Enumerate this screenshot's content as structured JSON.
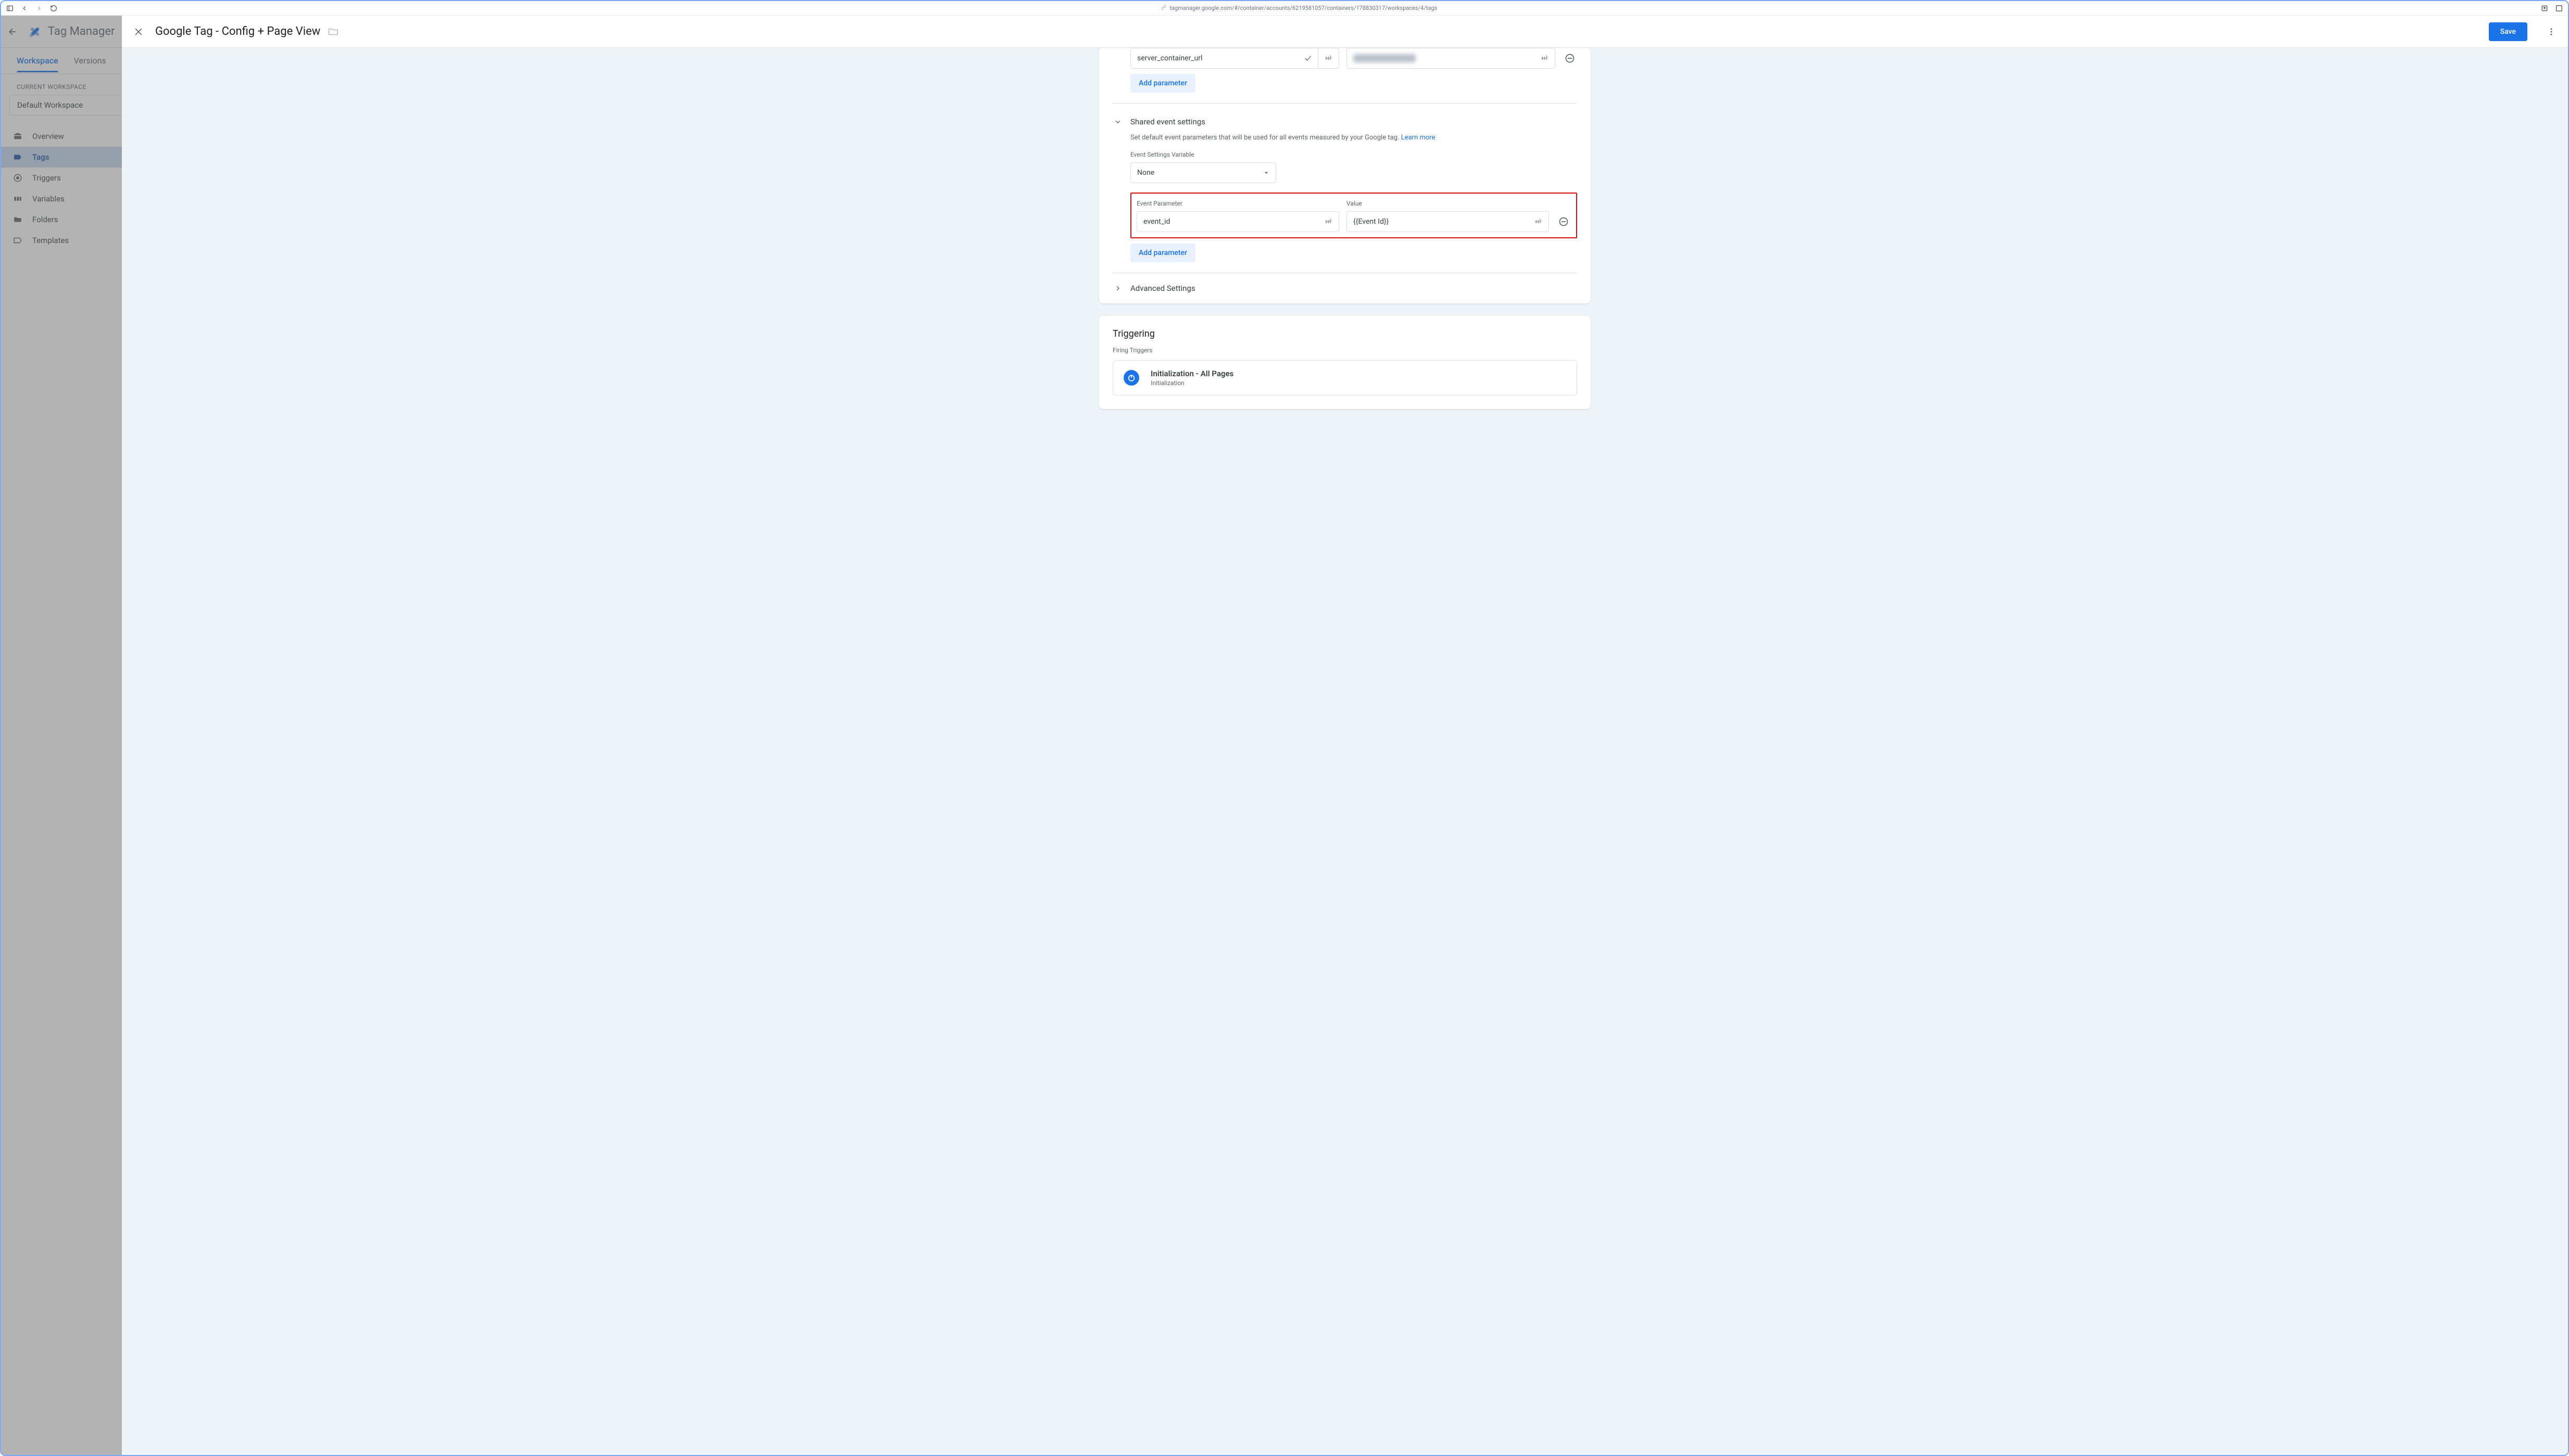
{
  "browser": {
    "url": "tagmanager.google.com/#/container/accounts/6219581057/containers/178830317/workspaces/4/tags"
  },
  "gtm": {
    "app_name": "Tag Manager",
    "tabs": {
      "workspace": "Workspace",
      "versions": "Versions"
    },
    "current_ws_label": "CURRENT WORKSPACE",
    "workspace_name": "Default Workspace",
    "nav": {
      "overview": "Overview",
      "tags": "Tags",
      "triggers": "Triggers",
      "variables": "Variables",
      "folders": "Folders",
      "templates": "Templates"
    }
  },
  "panel": {
    "title": "Google Tag - Config + Page View",
    "save": "Save"
  },
  "config": {
    "params_row1": {
      "name": "server_container_url"
    },
    "add_parameter": "Add parameter",
    "shared_header": "Shared event settings",
    "shared_help": "Set default event parameters that will be used for all events measured by your Google tag. ",
    "learn_more": "Learn more",
    "settings_var_label": "Event Settings Variable",
    "settings_var_value": "None",
    "cols": {
      "param": "Event Parameter",
      "value": "Value"
    },
    "event_row": {
      "param": "event_id",
      "value": "{{Event Id}}"
    },
    "advanced": "Advanced Settings"
  },
  "trigger": {
    "section": "Triggering",
    "firing_label": "Firing Triggers",
    "row_title": "Initialization - All Pages",
    "row_sub": "Initialization"
  }
}
